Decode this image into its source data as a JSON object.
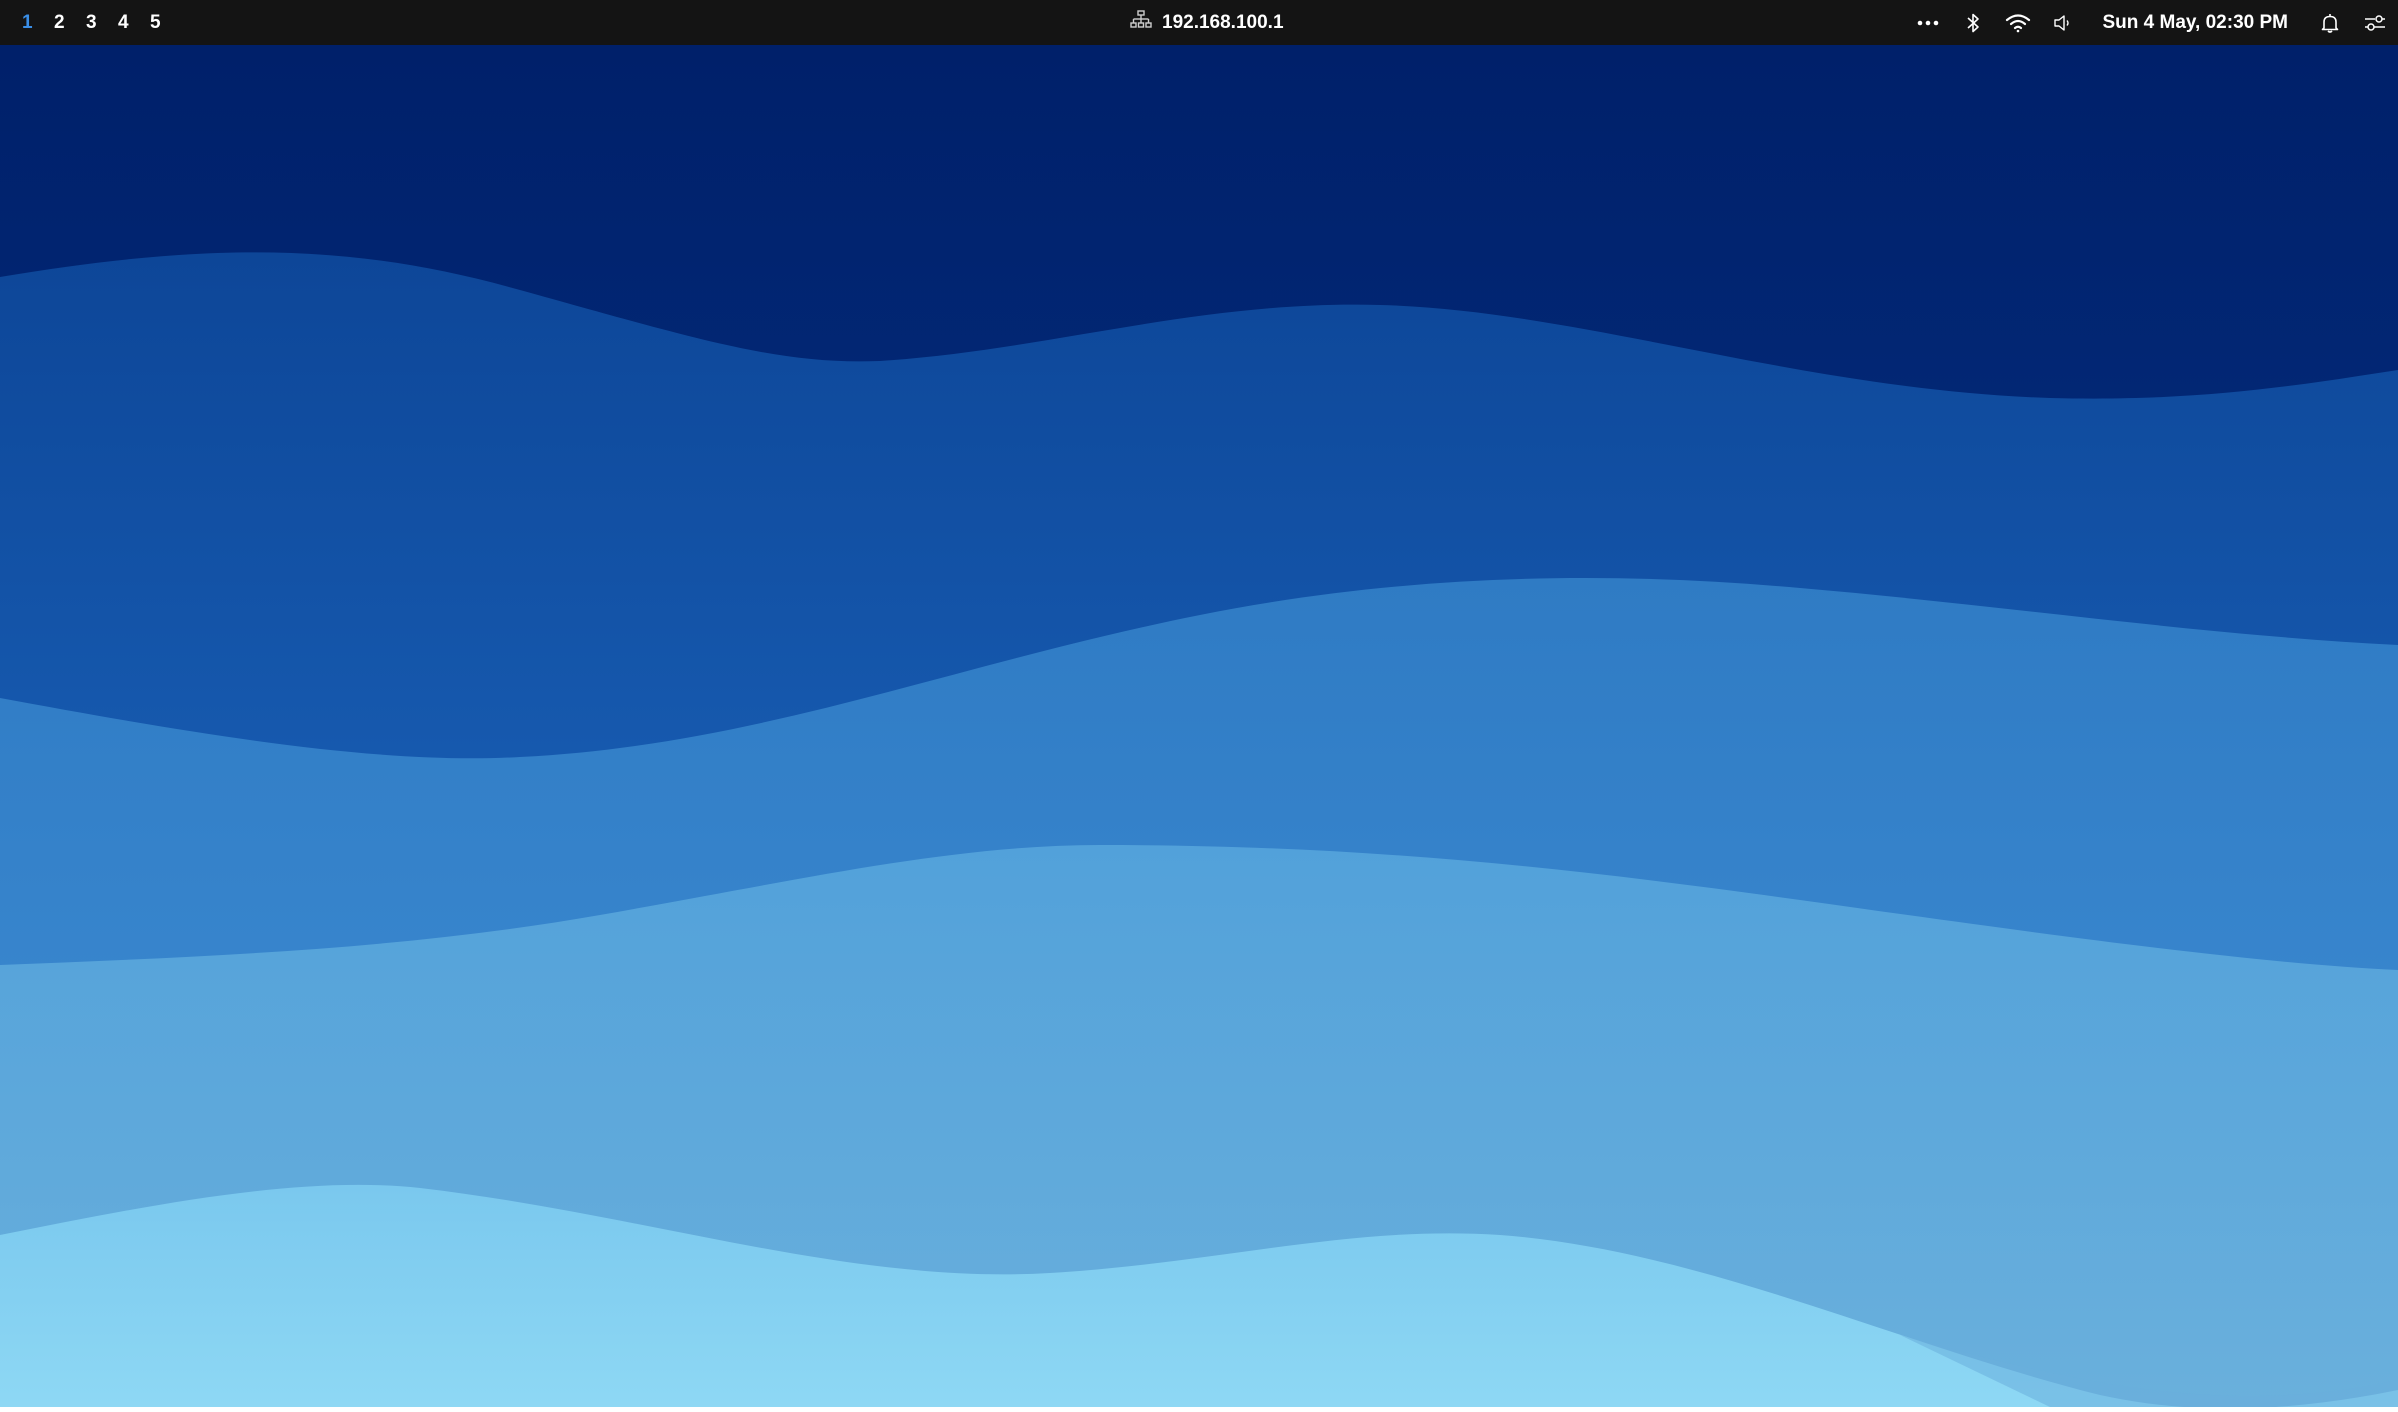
{
  "topbar": {
    "workspaces": [
      {
        "label": "1",
        "active": true
      },
      {
        "label": "2",
        "active": false
      },
      {
        "label": "3",
        "active": false
      },
      {
        "label": "4",
        "active": false
      },
      {
        "label": "5",
        "active": false
      }
    ],
    "network": {
      "icon": "wired-network-icon",
      "address": "192.168.100.1"
    },
    "tray": {
      "overflow_icon": "more-horizontal-icon",
      "bluetooth_icon": "bluetooth-icon",
      "wifi_icon": "wifi-icon",
      "volume_icon": "volume-icon",
      "clock": "Sun 4 May, 02:30 PM",
      "notifications_icon": "bell-icon",
      "quick_settings_icon": "sliders-icon"
    },
    "colors": {
      "bar_background": "#141414",
      "active_workspace": "#3a8ee6",
      "text": "#ffffff"
    }
  },
  "wallpaper": {
    "colors": [
      "#00206a",
      "#0a3e8e",
      "#1a5eb0",
      "#2a7ccc",
      "#4896d8",
      "#62aadc",
      "#86d4f2"
    ]
  }
}
